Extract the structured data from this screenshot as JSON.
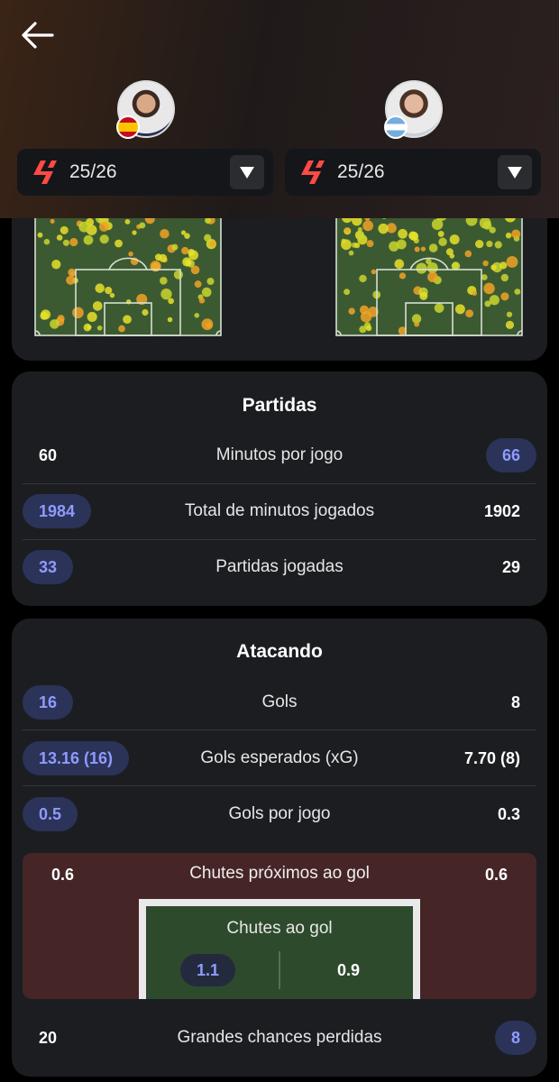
{
  "header": {
    "players": [
      {
        "season": "25/26",
        "flag": "spain",
        "league_logo": "laliga-logo"
      },
      {
        "season": "25/26",
        "flag": "argentina",
        "league_logo": "laliga-logo"
      }
    ]
  },
  "matches": {
    "title": "Partidas",
    "rows": [
      {
        "label": "Minutos por jogo",
        "left": "60",
        "right": "66",
        "highlight": "right"
      },
      {
        "label": "Total de minutos jogados",
        "left": "1984",
        "right": "1902",
        "highlight": "left"
      },
      {
        "label": "Partidas jogadas",
        "left": "33",
        "right": "29",
        "highlight": "left"
      }
    ]
  },
  "attack": {
    "title": "Atacando",
    "rows": [
      {
        "label": "Gols",
        "left": "16",
        "right": "8",
        "highlight": "left"
      },
      {
        "label": "Gols esperados (xG)",
        "left": "13.16 (16)",
        "right": "7.70 (8)",
        "highlight": "left"
      },
      {
        "label": "Gols por jogo",
        "left": "0.5",
        "right": "0.3",
        "highlight": "left"
      }
    ],
    "shots_near": {
      "label": "Chutes próximos ao gol",
      "left": "0.6",
      "right": "0.6"
    },
    "shots_on_target": {
      "label": "Chutes ao gol",
      "left": "1.1",
      "right": "0.9"
    },
    "big_chances": {
      "label": "Grandes chances perdidas",
      "left": "20",
      "right": "8",
      "highlight": "right"
    }
  },
  "colors": {
    "highlight_bg": "#2c3358",
    "highlight_text": "#8e9bff",
    "card_bg": "#1b1d21",
    "shots_bg": "#462526",
    "pitch_green": "#3c5a32"
  }
}
